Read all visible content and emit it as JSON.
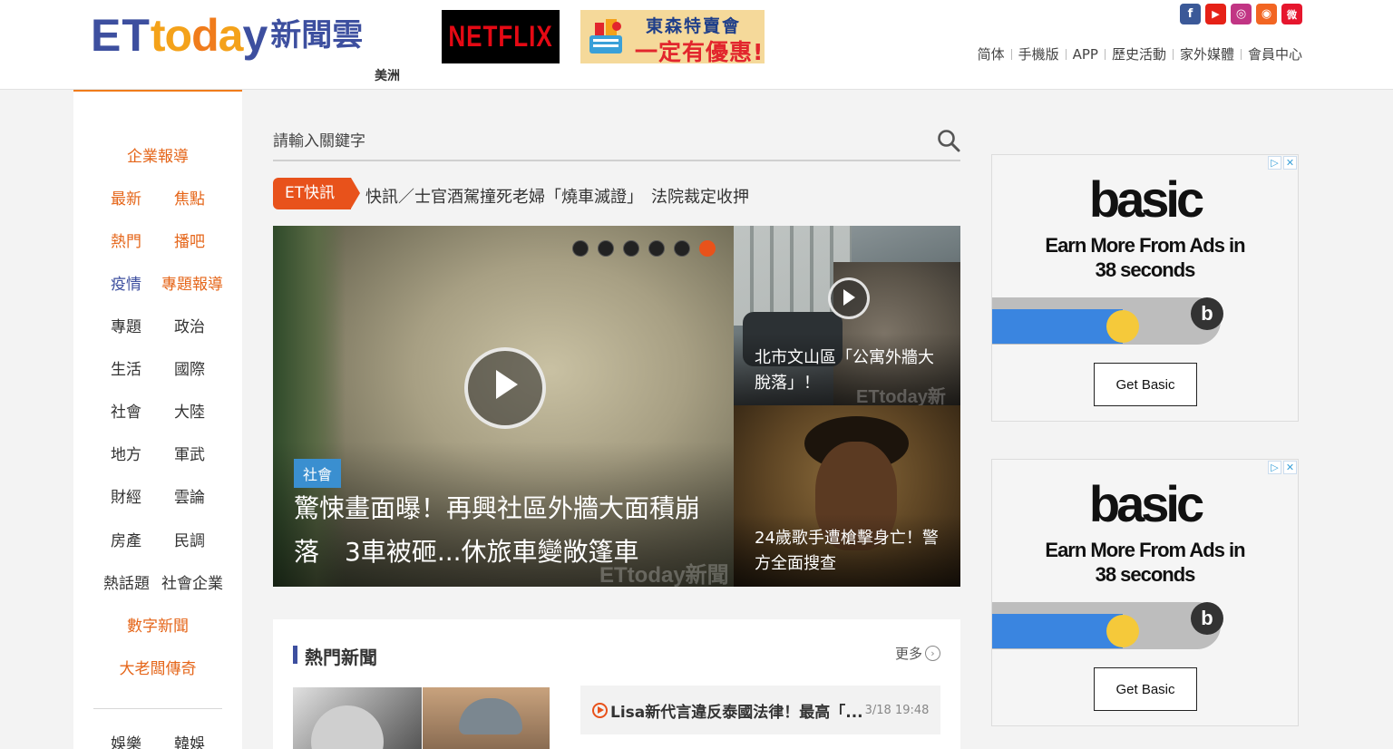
{
  "header": {
    "logo_et": "ET",
    "logo_today_1": "to",
    "logo_today_2": "d",
    "logo_today_3": "a",
    "logo_today_4": "y",
    "logo_cn": "新聞雲",
    "region": "美洲",
    "netflix_label": "NETFLIX",
    "promo_line1": "東森特賣會",
    "promo_line2": "一定有優惠!",
    "social": [
      {
        "name": "facebook-icon",
        "glyph": "f",
        "color": "#3b5998"
      },
      {
        "name": "youtube-icon",
        "glyph": "▶",
        "color": "#e62117"
      },
      {
        "name": "instagram-icon",
        "glyph": "◎",
        "color": "#c13584"
      },
      {
        "name": "rss-icon",
        "glyph": "◉",
        "color": "#f26522"
      },
      {
        "name": "weibo-icon",
        "glyph": "微",
        "color": "#e6162d"
      }
    ],
    "links": [
      "简体",
      "手機版",
      "APP",
      "歷史活動",
      "家外媒體",
      "會員中心"
    ]
  },
  "nav": {
    "corporate": "企業報導",
    "latest": "最新",
    "focus": "焦點",
    "hot": "熱門",
    "podcast": "播吧",
    "epidemic": "疫情",
    "special_report": "專題報導",
    "topics": "專題",
    "politics": "政治",
    "life": "生活",
    "international": "國際",
    "society": "社會",
    "mainland": "大陸",
    "local": "地方",
    "military": "軍武",
    "finance": "財經",
    "opinion": "雲論",
    "property": "房產",
    "poll": "民調",
    "hot_topics": "熱話題",
    "social_enterprise": "社會企業",
    "digital_news": "數字新聞",
    "tycoon": "大老闆傳奇",
    "entertainment": "娛樂",
    "korean": "韓娛"
  },
  "search": {
    "placeholder": "請輸入關鍵字"
  },
  "flash": {
    "badge": "ET快訊",
    "text": "快訊／士官酒駕撞死老婦「燒車滅證」　法院裁定收押"
  },
  "slider": {
    "dots_total": 6,
    "active_dot": 5,
    "tag": "社會",
    "title": "驚悚畫面曝！再興社區外牆大面積崩落　3車被砸...休旅車變敞篷車",
    "watermark": "ETtoday新聞",
    "side": [
      {
        "title": "北市文山區「公寓外牆大脫落」！",
        "watermark": "ETtoday新"
      },
      {
        "title": "24歲歌手遭槍擊身亡！警方全面搜查"
      }
    ]
  },
  "hot_news": {
    "title": "熱門新聞",
    "more": "更多",
    "more_icon": "chevron-right-circle-icon",
    "items": [
      {
        "title": "Lisa新代言違反泰國法律！最高「...",
        "time": "3/18 19:48"
      }
    ]
  },
  "ads": [
    {
      "brand": "basic",
      "tagline_1": "Earn More From Ads in",
      "tagline_2": "38 seconds",
      "cta": "Get Basic",
      "progress": 0.57,
      "adchoice_1": "▷",
      "adchoice_2": "✕"
    },
    {
      "brand": "basic",
      "tagline_1": "Earn More From Ads in",
      "tagline_2": "38 seconds",
      "cta": "Get Basic",
      "progress": 0.57,
      "adchoice_1": "▷",
      "adchoice_2": "✕"
    }
  ],
  "colors": {
    "brand_blue": "#3d4f9f",
    "brand_orange": "#f07c1c",
    "flash_orange": "#e8521b",
    "ad_blue": "#3a85e0",
    "ad_yellow": "#f5c93a"
  }
}
